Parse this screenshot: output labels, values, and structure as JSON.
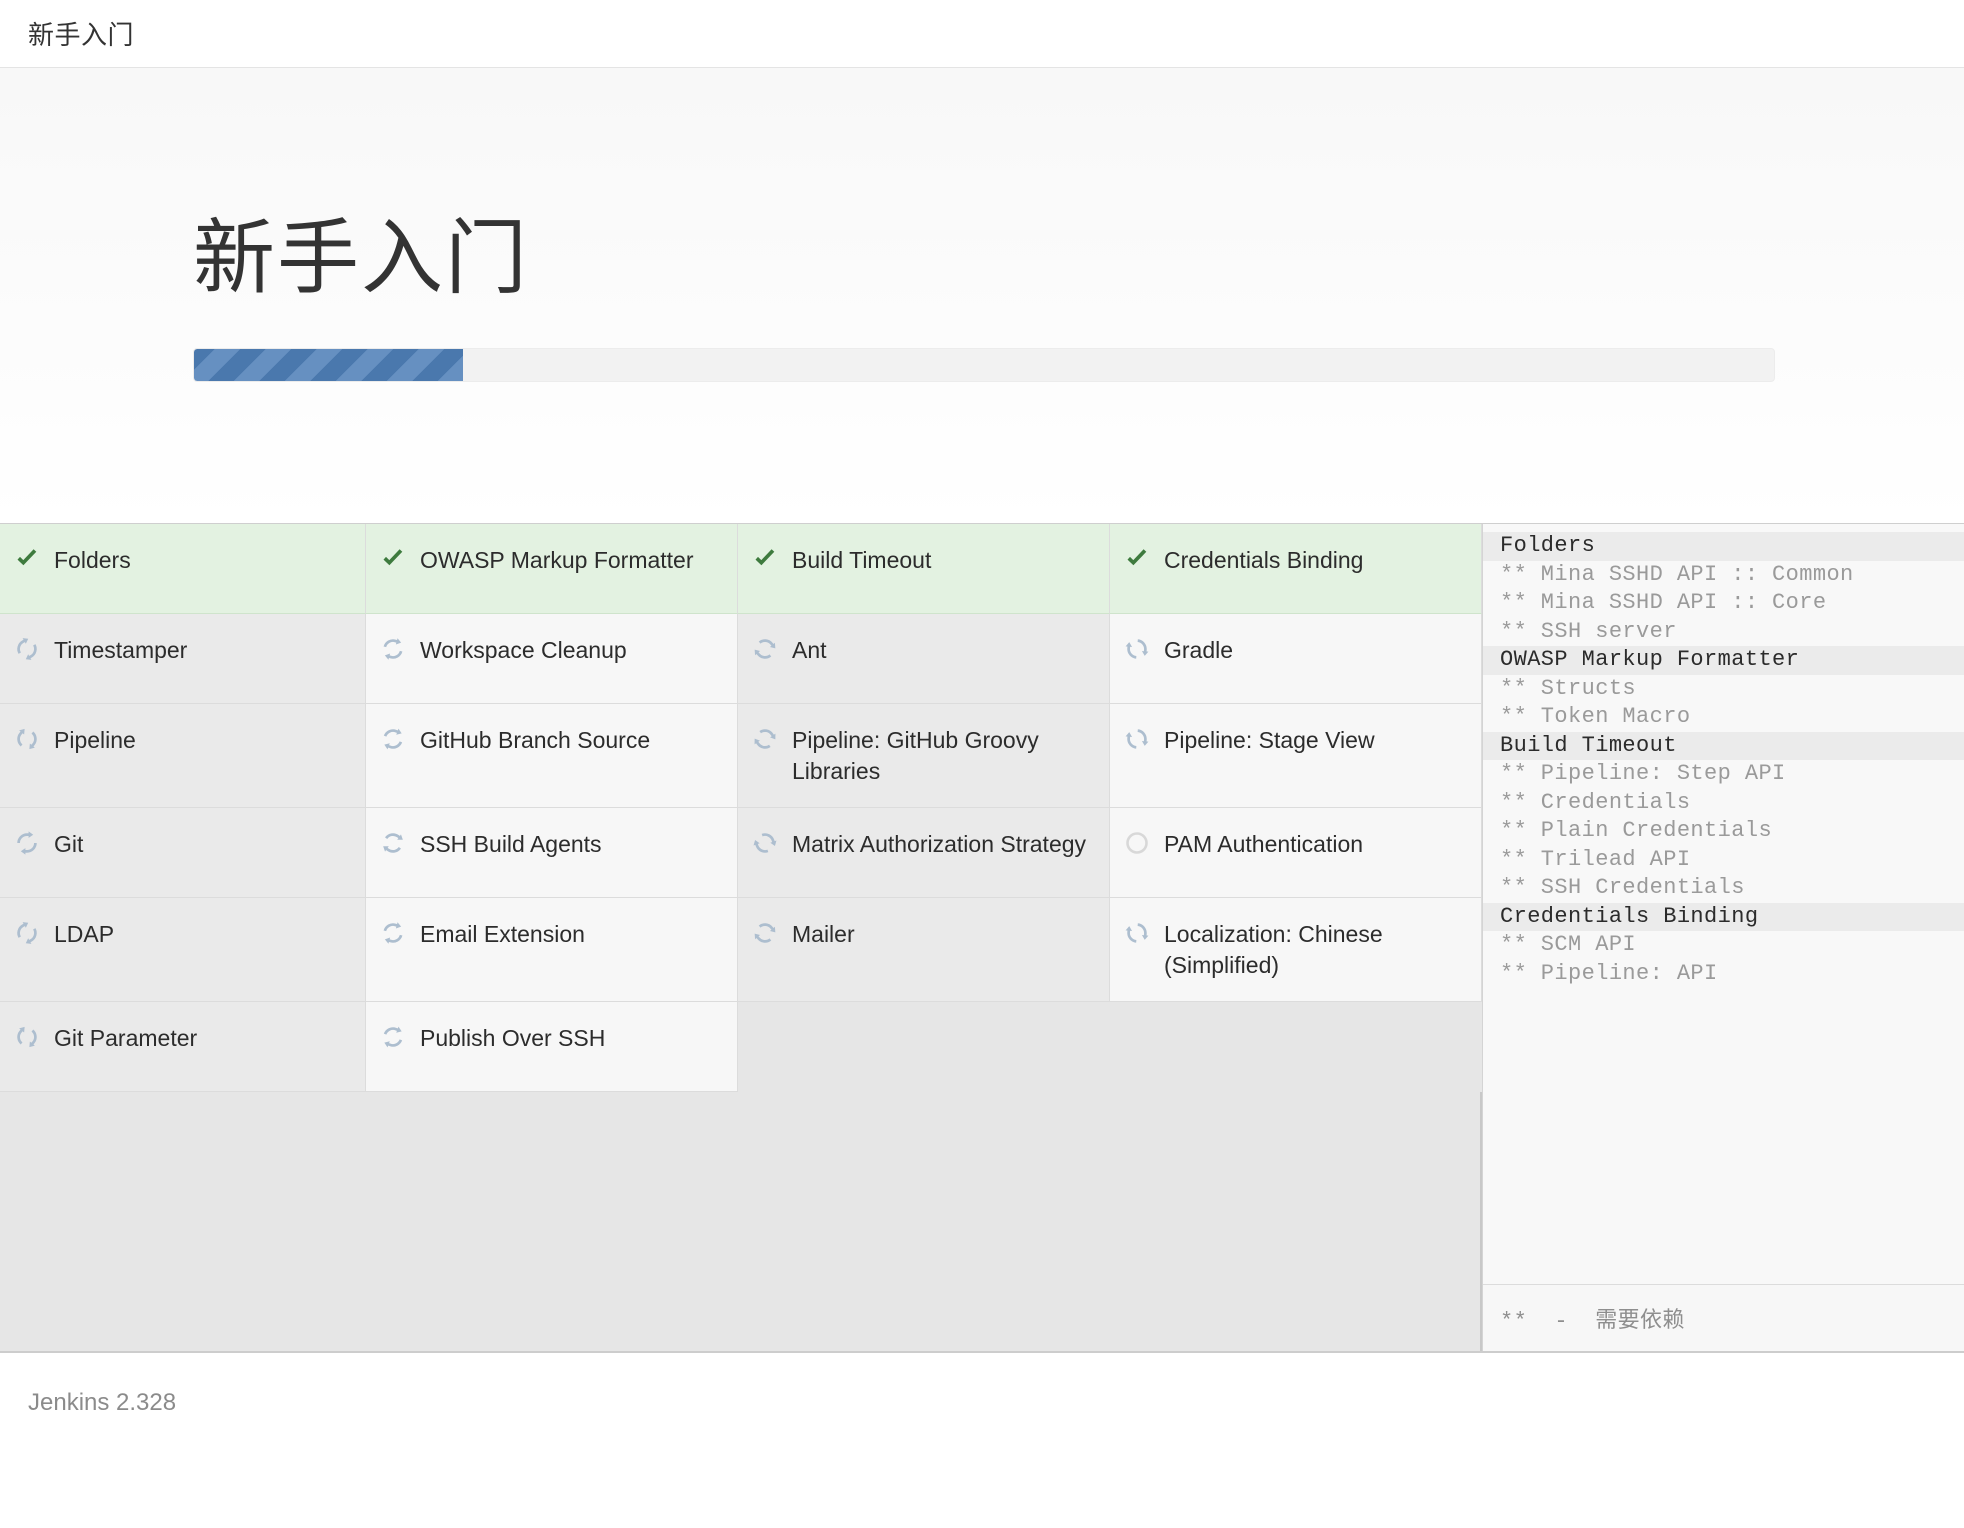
{
  "topbar": {
    "title": "新手入门"
  },
  "hero": {
    "title": "新手入门",
    "progress_percent": 17,
    "progress_color": "#4f7fb8",
    "track_color": "#f2f2f2"
  },
  "colors": {
    "done_background": "#e3f2e1",
    "done_check": "#3e7b3e",
    "pending_icon": "#adbecf",
    "inactive_icon": "#d8d8d8"
  },
  "plugins": [
    {
      "name": "Folders",
      "status": "done",
      "icon": "check-icon"
    },
    {
      "name": "OWASP Markup Formatter",
      "status": "done",
      "icon": "check-icon"
    },
    {
      "name": "Build Timeout",
      "status": "done",
      "icon": "check-icon"
    },
    {
      "name": "Credentials Binding",
      "status": "done",
      "icon": "check-icon"
    },
    {
      "name": "Timestamper",
      "status": "installing",
      "icon": "spinner-icon"
    },
    {
      "name": "Workspace Cleanup",
      "status": "installing",
      "icon": "spinner-icon"
    },
    {
      "name": "Ant",
      "status": "installing",
      "icon": "spinner-icon"
    },
    {
      "name": "Gradle",
      "status": "installing",
      "icon": "spinner-icon"
    },
    {
      "name": "Pipeline",
      "status": "installing",
      "icon": "spinner-icon"
    },
    {
      "name": "GitHub Branch Source",
      "status": "installing",
      "icon": "spinner-icon"
    },
    {
      "name": "Pipeline: GitHub Groovy Libraries",
      "status": "installing",
      "icon": "spinner-icon"
    },
    {
      "name": "Pipeline: Stage View",
      "status": "installing",
      "icon": "spinner-icon"
    },
    {
      "name": "Git",
      "status": "installing",
      "icon": "spinner-icon"
    },
    {
      "name": "SSH Build Agents",
      "status": "installing",
      "icon": "spinner-icon"
    },
    {
      "name": "Matrix Authorization Strategy",
      "status": "installing",
      "icon": "spinner-icon"
    },
    {
      "name": "PAM Authentication",
      "status": "pending",
      "icon": "circle-icon"
    },
    {
      "name": "LDAP",
      "status": "installing",
      "icon": "spinner-icon"
    },
    {
      "name": "Email Extension",
      "status": "installing",
      "icon": "spinner-icon"
    },
    {
      "name": "Mailer",
      "status": "installing",
      "icon": "spinner-icon"
    },
    {
      "name": "Localization: Chinese (Simplified)",
      "status": "installing",
      "icon": "spinner-icon"
    },
    {
      "name": "Git Parameter",
      "status": "installing",
      "icon": "spinner-icon"
    },
    {
      "name": "Publish Over SSH",
      "status": "installing",
      "icon": "spinner-icon"
    }
  ],
  "log": {
    "lines": [
      {
        "text": "Folders",
        "type": "head"
      },
      {
        "text": "** Mina SSHD API :: Common",
        "type": "dep"
      },
      {
        "text": "** Mina SSHD API :: Core",
        "type": "dep"
      },
      {
        "text": "** SSH server",
        "type": "dep"
      },
      {
        "text": "OWASP Markup Formatter",
        "type": "head"
      },
      {
        "text": "** Structs",
        "type": "dep"
      },
      {
        "text": "** Token Macro",
        "type": "dep"
      },
      {
        "text": "Build Timeout",
        "type": "head"
      },
      {
        "text": "** Pipeline: Step API",
        "type": "dep"
      },
      {
        "text": "** Credentials",
        "type": "dep"
      },
      {
        "text": "** Plain Credentials",
        "type": "dep"
      },
      {
        "text": "** Trilead API",
        "type": "dep"
      },
      {
        "text": "** SSH Credentials",
        "type": "dep"
      },
      {
        "text": "Credentials Binding",
        "type": "head"
      },
      {
        "text": "** SCM API",
        "type": "dep"
      },
      {
        "text": "** Pipeline: API",
        "type": "dep"
      }
    ],
    "legend": "**  -  需要依赖"
  },
  "footer": {
    "version": "Jenkins 2.328"
  }
}
